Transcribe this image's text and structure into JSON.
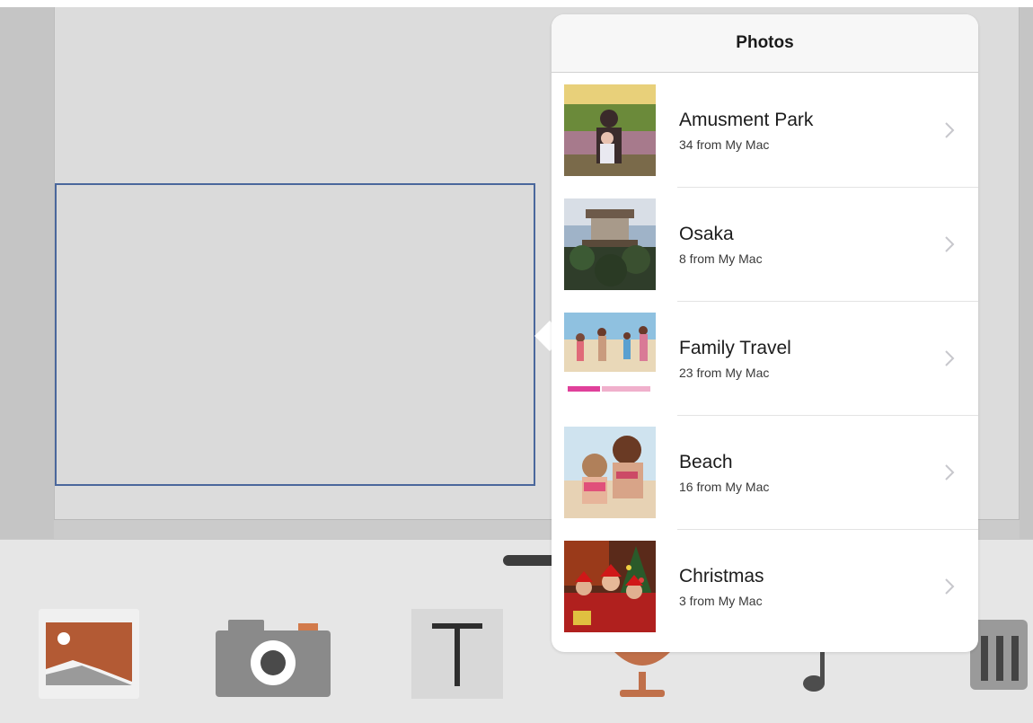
{
  "popover": {
    "title": "Photos",
    "albums": [
      {
        "name": "Amusment Park",
        "count": "34 from My Mac"
      },
      {
        "name": "Osaka",
        "count": "8 from My Mac"
      },
      {
        "name": "Family Travel",
        "count": "23 from My Mac"
      },
      {
        "name": "Beach",
        "count": "16 from My Mac"
      },
      {
        "name": "Christmas",
        "count": "3 from My Mac"
      }
    ]
  },
  "toolbar": {
    "tools": [
      "image-icon",
      "camera-icon",
      "text-icon",
      "microphone-icon",
      "music-note-icon",
      "trash-icon"
    ]
  },
  "colors": {
    "selection_border": "#4a679c",
    "microphone": "#c0704a",
    "photo_tool": "#b35a34"
  }
}
